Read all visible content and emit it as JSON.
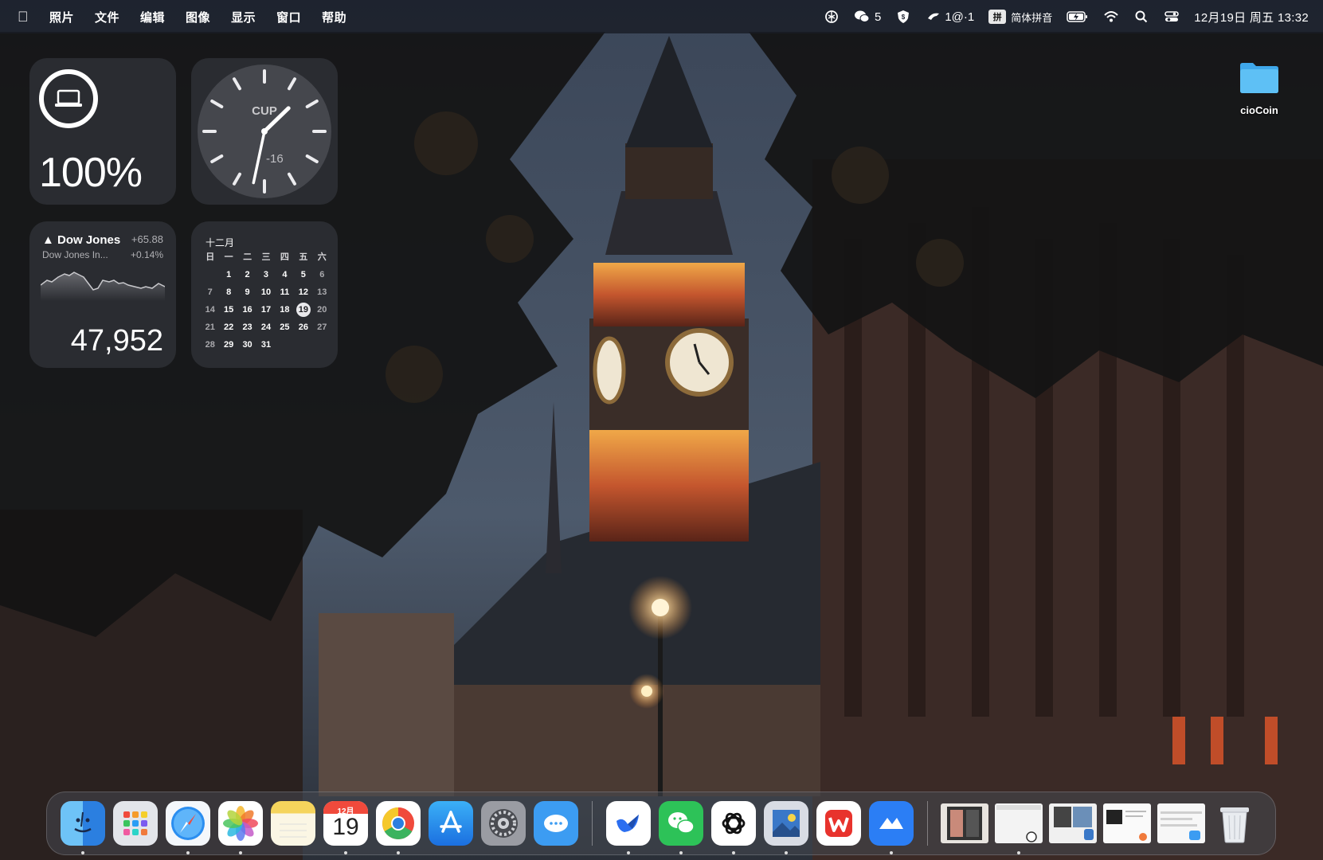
{
  "menubar": {
    "apple_icon": "apple-icon",
    "menus": [
      "照片",
      "文件",
      "编辑",
      "图像",
      "显示",
      "窗口",
      "帮助"
    ],
    "status": {
      "wechat_count": "5",
      "shortcut_text": "1@·1",
      "ime_badge": "拼",
      "ime_name": "简体拼音",
      "datetime": "12月19日 周五  13:32"
    }
  },
  "widgets": {
    "battery": {
      "percent": "100%"
    },
    "clock": {
      "city": "CUP",
      "offset": "-16",
      "hour": 13,
      "minute": 32
    },
    "stock": {
      "name": "▲ Dow Jones",
      "change": "+65.88",
      "full_name": "Dow Jones In...",
      "change_pct": "+0.14%",
      "value": "47,952"
    },
    "calendar": {
      "month": "十二月",
      "weekdays": [
        "日",
        "一",
        "二",
        "三",
        "四",
        "五",
        "六"
      ],
      "today": 19,
      "first_weekday_index": 1,
      "days_in_month": 31
    }
  },
  "desktop": {
    "folder_label": "cioCoin"
  },
  "dock": {
    "calendar_month": "12月",
    "calendar_day": "19",
    "apps": [
      {
        "name": "finder",
        "color": "#2b8cf0"
      },
      {
        "name": "launchpad",
        "color": "#dfe2e8"
      },
      {
        "name": "safari",
        "color": "#e8f1fb"
      },
      {
        "name": "photos",
        "color": "#ffffff"
      },
      {
        "name": "notes",
        "color": "#f5d76e"
      },
      {
        "name": "calendar",
        "color": "#ffffff"
      },
      {
        "name": "chrome",
        "color": "#ffffff"
      },
      {
        "name": "app-store",
        "color": "#1f8ff5"
      },
      {
        "name": "system-settings",
        "color": "#8c8f96"
      },
      {
        "name": "messages-app",
        "color": "#3a9bf2"
      }
    ]
  }
}
